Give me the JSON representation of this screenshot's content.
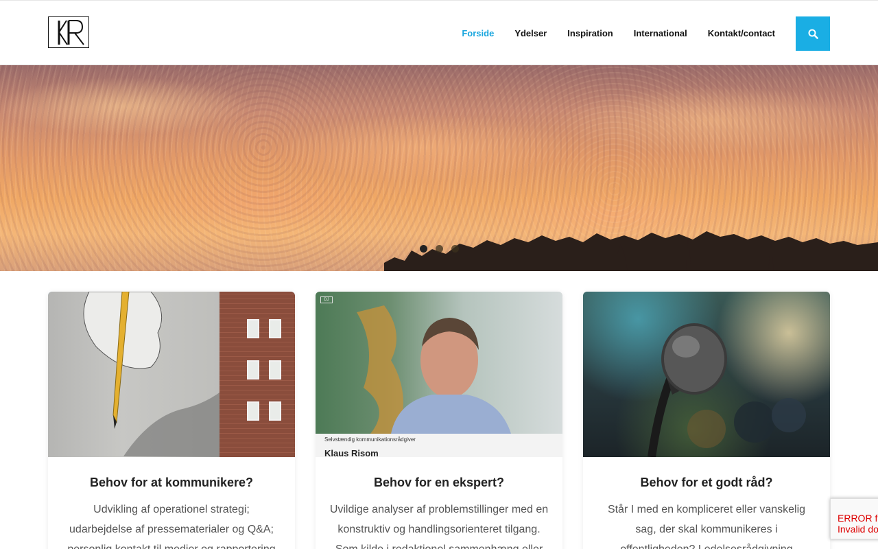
{
  "header": {
    "logo_alt": "KR",
    "nav": [
      {
        "label": "Forside",
        "active": true
      },
      {
        "label": "Ydelser",
        "active": false
      },
      {
        "label": "Inspiration",
        "active": false
      },
      {
        "label": "International",
        "active": false
      },
      {
        "label": "Kontakt/contact",
        "active": false
      }
    ],
    "search_icon": "search-icon",
    "accent_color": "#1aa6de"
  },
  "hero": {
    "slides": 3,
    "active_slide": 1
  },
  "cards": [
    {
      "title": "Behov for at kommunikere?",
      "text": "Udvikling af operationel strategi; udarbejdelse af pressematerialer og Q&A; personlig kontakt til medier og rapportering"
    },
    {
      "title": "Behov for en ekspert?",
      "text": "Uvildige analyser af problemstillinger med en konstruktiv og handlingsorienteret tilgang. Som kilde i redaktionel sammenhæng eller",
      "video_overlay": {
        "badge": "DJ",
        "caption": "Selvstændig kommunikationsrådgiver",
        "name": "Klaus Risom"
      }
    },
    {
      "title": "Behov for et godt råd?",
      "text": "Står I med en kompliceret eller vanskelig sag, der skal kommunikeres i offentligheden? Ledelsesrådgivning"
    }
  ],
  "recaptcha": {
    "line1": "ERROR for",
    "line2": "Invalid do"
  }
}
